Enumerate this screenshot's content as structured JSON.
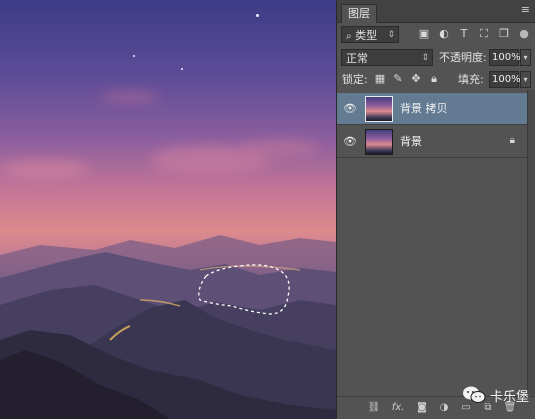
{
  "layers_panel": {
    "tab_label": "图层",
    "filter_kind": "类型",
    "blend_mode": "正常",
    "opacity_label": "不透明度:",
    "opacity_value": "100%",
    "lock_label": "锁定:",
    "fill_label": "填充:",
    "fill_value": "100%",
    "layers": [
      {
        "name": "背景 拷贝",
        "selected": true,
        "visible": true,
        "locked": false
      },
      {
        "name": "背景",
        "selected": false,
        "visible": true,
        "locked": true
      }
    ],
    "bottom_icons": [
      "link-icon",
      "fx-icon",
      "mask-icon",
      "adjustment-icon",
      "group-folder-icon",
      "new-layer-icon",
      "trash-icon"
    ],
    "bottom_labels": {
      "fx": "fx."
    }
  },
  "watermark": {
    "text": "卡乐堡"
  },
  "colors": {
    "panel_bg": "#535353",
    "selected_layer": "#627a92",
    "marching_ants": "#ffffff"
  }
}
